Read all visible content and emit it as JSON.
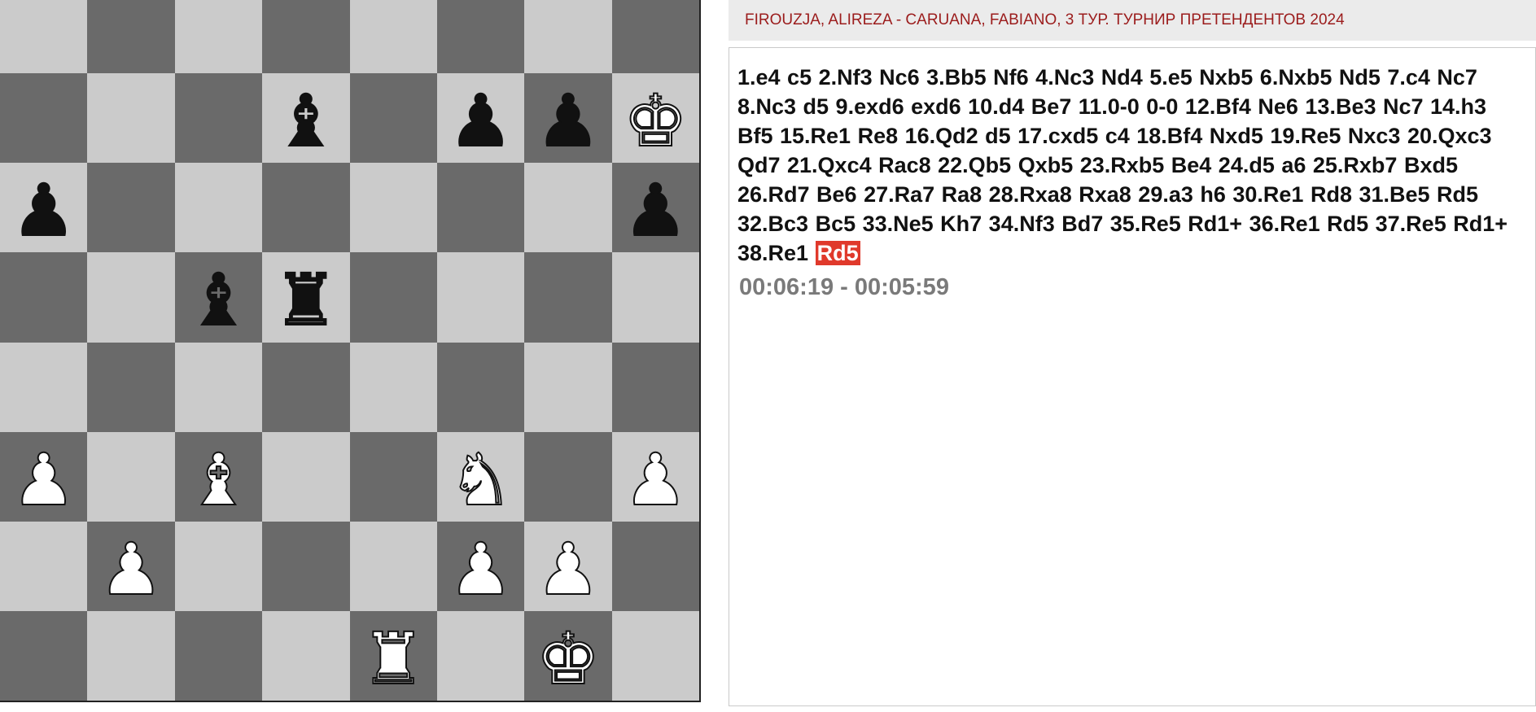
{
  "game": {
    "title": "FIROUZJA, ALIREZA - CARUANA, FABIANO, 3 ТУР. ТУРНИР ПРЕТЕНДЕНТОВ 2024",
    "moves_text": "1.e4 c5 2.Nf3 Nc6 3.Bb5 Nf6 4.Nc3 Nd4 5.e5 Nxb5 6.Nxb5 Nd5 7.c4 Nc7 8.Nc3 d5 9.exd6 exd6 10.d4 Be7 11.0-0 0-0 12.Bf4 Ne6 13.Be3 Nc7 14.h3 Bf5 15.Re1 Re8 16.Qd2 d5 17.cxd5 c4 18.Bf4 Nxd5 19.Re5 Nxc3 20.Qxc3 Qd7 21.Qxc4 Rac8 22.Qb5 Qxb5 23.Rxb5 Be4 24.d5 a6 25.Rxb7 Bxd5 26.Rd7 Be6 27.Ra7 Ra8 28.Rxa8 Rxa8 29.a3 h6 30.Re1 Rd8 31.Be5 Rd5 32.Bc3 Bc5 33.Ne5 Kh7 34.Nf3 Bd7 35.Re5 Rd1+ 36.Re1 Rd5 37.Re5 Rd1+ 38.Re1",
    "current_move": "Rd5",
    "clock": "00:06:19 - 00:05:59"
  },
  "board": {
    "light_color": "#cbcbcb",
    "dark_color": "#6a6a6a",
    "ranks": [
      [
        "",
        "",
        "",
        "",
        "",
        "",
        "",
        ""
      ],
      [
        "",
        "",
        "",
        "black-bishop-icon",
        "",
        "black-pawn-icon",
        "black-pawn-icon",
        "white-king-icon"
      ],
      [
        "black-pawn-icon",
        "",
        "",
        "",
        "",
        "",
        "",
        "black-pawn-icon"
      ],
      [
        "",
        "",
        "black-bishop-icon",
        "black-rook-icon",
        "",
        "",
        "",
        ""
      ],
      [
        "",
        "",
        "",
        "",
        "",
        "",
        "",
        ""
      ],
      [
        "white-pawn-icon",
        "",
        "white-bishop-icon",
        "",
        "",
        "white-knight-icon",
        "",
        "white-pawn-icon"
      ],
      [
        "",
        "white-pawn-icon",
        "",
        "",
        "",
        "white-pawn-icon",
        "white-pawn-icon",
        ""
      ],
      [
        "",
        "",
        "",
        "",
        "white-rook-icon",
        "",
        "white-king-icon",
        ""
      ]
    ]
  },
  "colors": {
    "title_text": "#9b1c1c",
    "highlight": "#e0392b",
    "clock_text": "#7a7a7a"
  }
}
